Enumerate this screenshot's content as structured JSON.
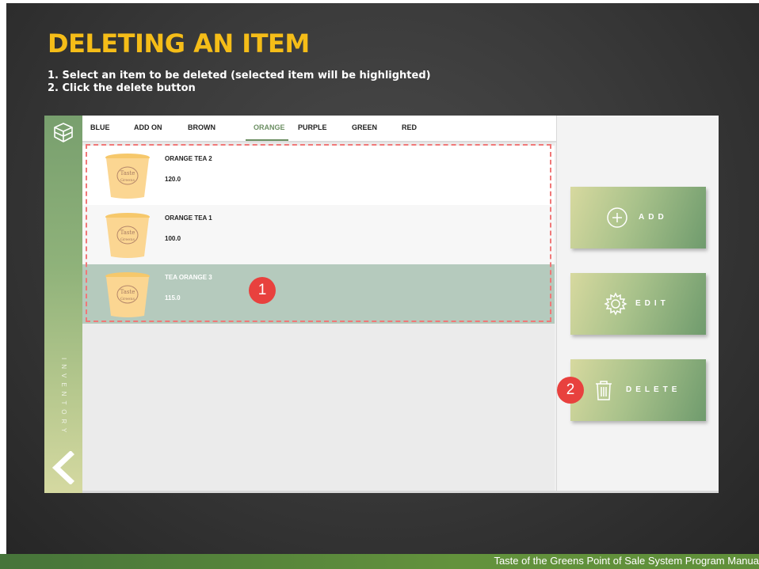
{
  "slide": {
    "title": "DELETING AN ITEM",
    "steps": [
      "1.  Select an item to be deleted (selected item will be highlighted)",
      "2.  Click the delete button"
    ],
    "footer": "Taste of the Greens Point of Sale System Program Manua"
  },
  "app": {
    "sidebar": {
      "label": "INVENTORY"
    },
    "tabs": [
      "BLUE",
      "ADD ON",
      "BROWN",
      "ORANGE",
      "PURPLE",
      "GREEN",
      "RED"
    ],
    "active_tab": "ORANGE",
    "items": [
      {
        "name": "ORANGE TEA 2",
        "price": "120.0",
        "selected": false
      },
      {
        "name": "ORANGE TEA 1",
        "price": "100.0",
        "selected": false
      },
      {
        "name": "TEA ORANGE 3",
        "price": "115.0",
        "selected": true
      }
    ],
    "cup_logo_text": [
      "Taste",
      "Greens"
    ],
    "buttons": {
      "add": "ADD",
      "edit": "EDIT",
      "delete": "DELETE"
    },
    "badges": [
      "1",
      "2"
    ]
  },
  "colors": {
    "title": "#f5bd18",
    "accent_green": "#6c8f63",
    "selected_row": "#b5cabd",
    "badge": "#e8413e"
  }
}
